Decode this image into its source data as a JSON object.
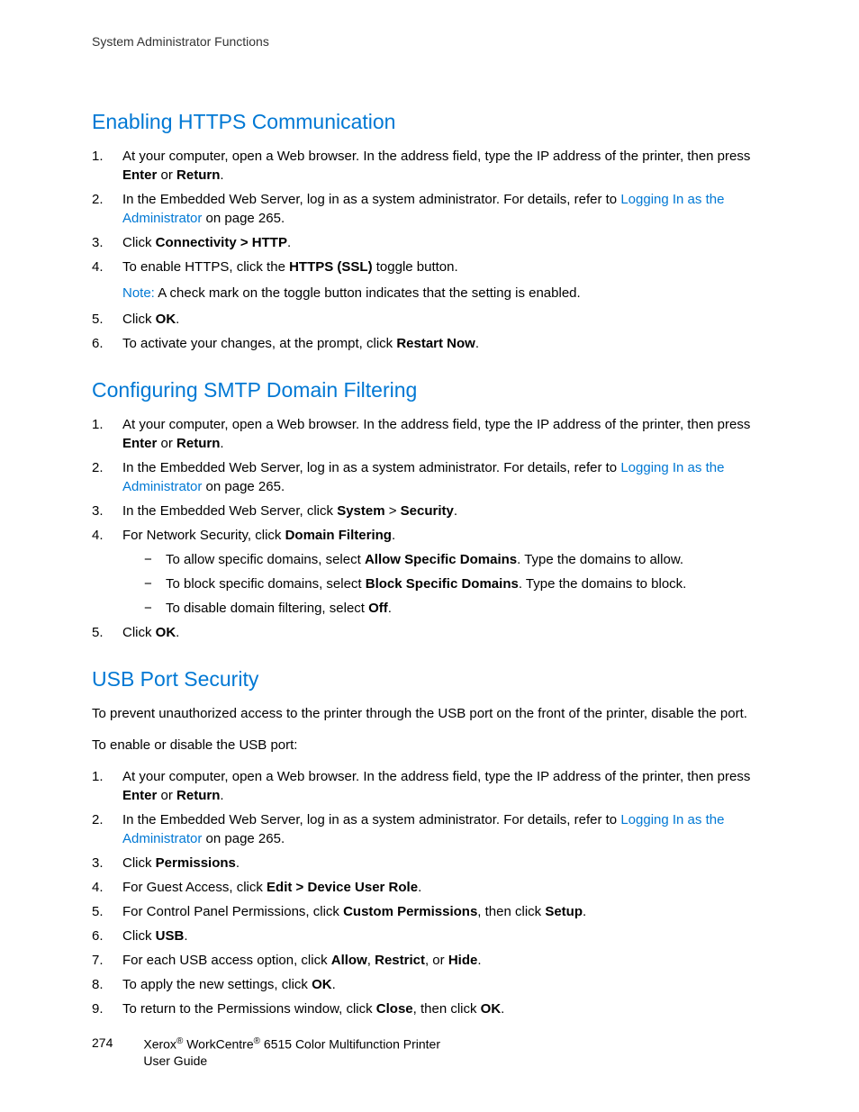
{
  "header": {
    "chapter": "System Administrator Functions"
  },
  "section1": {
    "title": "Enabling HTTPS Communication",
    "step1a": "At your computer, open a Web browser. In the address field, type the IP address of the printer, then press ",
    "step1b": "Enter",
    "step1c": " or ",
    "step1d": "Return",
    "step1e": ".",
    "step2a": "In the Embedded Web Server, log in as a system administrator. For details, refer to ",
    "step2link": "Logging In as the Administrator",
    "step2b": " on page 265.",
    "step3a": "Click ",
    "step3b": "Connectivity",
    "step3c": " > ",
    "step3d": "HTTP",
    "step3e": ".",
    "step4a": "To enable HTTPS, click the ",
    "step4b": "HTTPS (SSL)",
    "step4c": " toggle button.",
    "noteLabel": "Note:",
    "noteText": " A check mark on the toggle button indicates that the setting is enabled.",
    "step5a": "Click ",
    "step5b": "OK",
    "step5c": ".",
    "step6a": "To activate your changes, at the prompt, click ",
    "step6b": "Restart Now",
    "step6c": "."
  },
  "section2": {
    "title": "Configuring SMTP Domain Filtering",
    "step1a": "At your computer, open a Web browser. In the address field, type the IP address of the printer, then press ",
    "step1b": "Enter",
    "step1c": " or ",
    "step1d": "Return",
    "step1e": ".",
    "step2a": "In the Embedded Web Server, log in as a system administrator. For details, refer to ",
    "step2link": "Logging In as the Administrator",
    "step2b": " on page 265.",
    "step3a": "In the Embedded Web Server, click ",
    "step3b": "System",
    "step3c": " > ",
    "step3d": "Security",
    "step3e": ".",
    "step4a": "For Network Security, click ",
    "step4b": "Domain Filtering",
    "step4c": ".",
    "sub1a": "To allow specific domains, select ",
    "sub1b": "Allow Specific Domains",
    "sub1c": ". Type the domains to allow.",
    "sub2a": "To block specific domains, select ",
    "sub2b": "Block Specific Domains",
    "sub2c": ". Type the domains to block.",
    "sub3a": "To disable domain filtering, select ",
    "sub3b": "Off",
    "sub3c": ".",
    "step5a": "Click ",
    "step5b": "OK",
    "step5c": "."
  },
  "section3": {
    "title": "USB Port Security",
    "intro": "To prevent unauthorized access to the printer through the USB port on the front of the printer, disable the port.",
    "lead": "To enable or disable the USB port:",
    "step1a": "At your computer, open a Web browser. In the address field, type the IP address of the printer, then press ",
    "step1b": "Enter",
    "step1c": " or ",
    "step1d": "Return",
    "step1e": ".",
    "step2a": "In the Embedded Web Server, log in as a system administrator. For details, refer to ",
    "step2link": "Logging In as the Administrator",
    "step2b": " on page 265.",
    "step3a": "Click ",
    "step3b": "Permissions",
    "step3c": ".",
    "step4a": "For Guest Access, click ",
    "step4b": "Edit",
    "step4c": " > ",
    "step4d": "Device User Role",
    "step4e": ".",
    "step5a": "For Control Panel Permissions, click ",
    "step5b": "Custom Permissions",
    "step5c": ", then click ",
    "step5d": "Setup",
    "step5e": ".",
    "step6a": "Click ",
    "step6b": "USB",
    "step6c": ".",
    "step7a": "For each USB access option, click ",
    "step7b": "Allow",
    "step7c": ", ",
    "step7d": "Restrict",
    "step7e": ", or ",
    "step7f": "Hide",
    "step7g": ".",
    "step8a": "To apply the new settings, click ",
    "step8b": "OK",
    "step8c": ".",
    "step9a": "To return to the Permissions window, click ",
    "step9b": "Close",
    "step9c": ", then click ",
    "step9d": "OK",
    "step9e": "."
  },
  "footer": {
    "page": "274",
    "line1a": "Xerox",
    "line1b": " WorkCentre",
    "line1c": " 6515 Color Multifunction Printer",
    "reg": "®",
    "line2": "User Guide"
  }
}
